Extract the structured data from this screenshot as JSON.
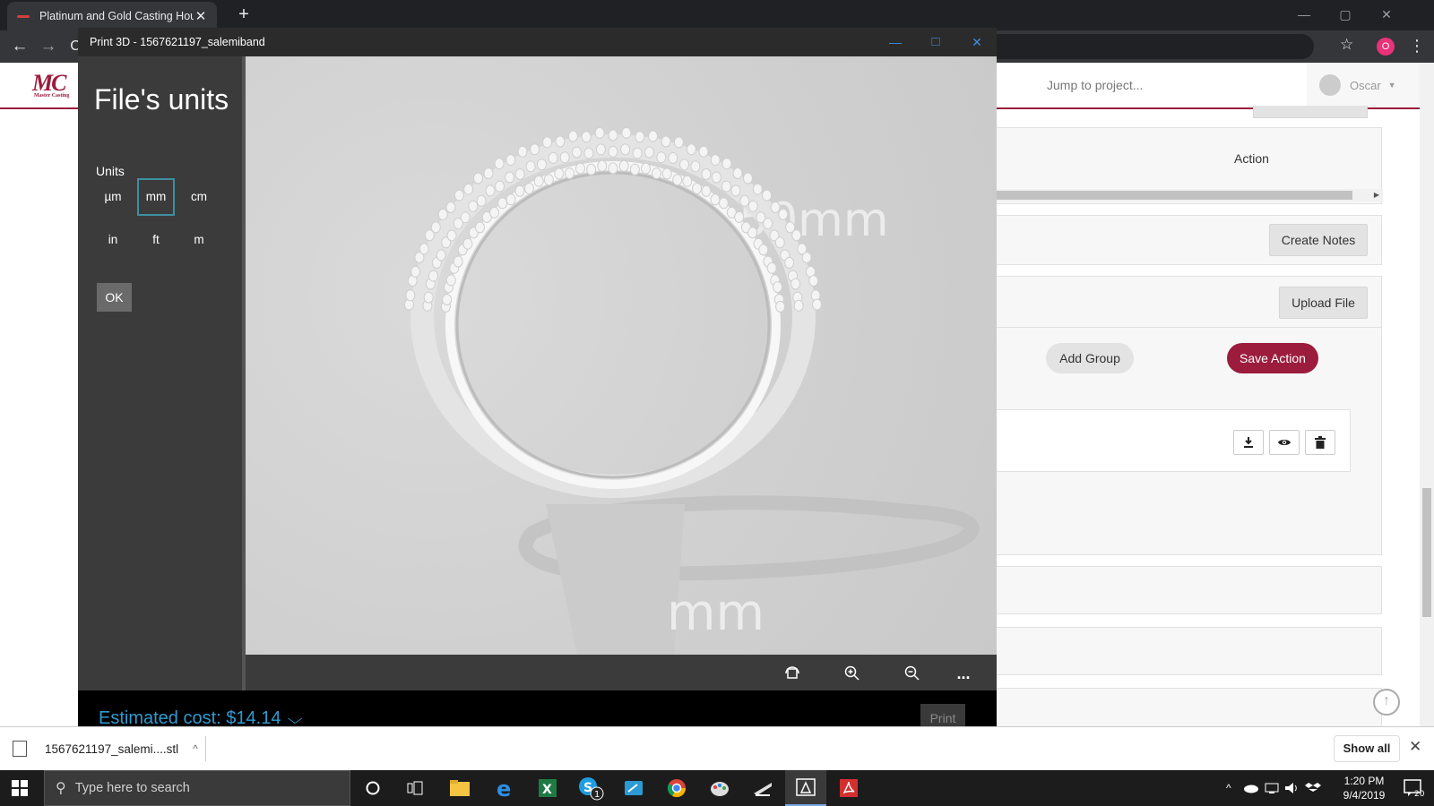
{
  "browser": {
    "tab_title": "Platinum and Gold Casting House",
    "tab_close": "✕",
    "new_tab": "+",
    "window_controls": [
      "—",
      "▢",
      "✕"
    ],
    "back": "←",
    "forward": "→",
    "reload": "C",
    "star": "☆",
    "profile_initial": "O",
    "menu": "⋮"
  },
  "site": {
    "logo_text": "MC",
    "logo_sub": "Master Casting",
    "jump_placeholder": "Jump to project...",
    "user_name": "Oscar",
    "user_caret": "▼",
    "action_header": "Action",
    "create_notes_label": "Create Notes",
    "upload_file_label": "Upload File",
    "add_group_label": "Add Group",
    "save_action_label": "Save Action",
    "scroll_right": "▶",
    "back_to_top": "↑"
  },
  "print3d": {
    "window_title": "Print 3D - 1567621197_salemiband",
    "controls": [
      "—",
      "□",
      "✕"
    ],
    "heading": "File's units",
    "units_label": "Units",
    "units": [
      "µm",
      "mm",
      "cm",
      "in",
      "ft",
      "m"
    ],
    "selected_unit": "mm",
    "ok_label": "OK",
    "viewport_labels": [
      "50mm",
      "mm"
    ],
    "toolbar_more": "...",
    "estimated_cost": "Estimated cost: $14.14",
    "cost_chevron": "⌵",
    "print_label": "Print"
  },
  "downloads": {
    "file_name": "1567621197_salemi....stl",
    "caret": "^",
    "show_all_label": "Show all",
    "close": "✕"
  },
  "taskbar": {
    "search_placeholder": "Type here to search",
    "search_icon": "⚲",
    "skype_badge": "1",
    "time": "1:20 PM",
    "date": "9/4/2019",
    "notification_count": "20",
    "tray_caret": "^"
  },
  "colors": {
    "brand": "#9b1c3d",
    "cost_blue": "#2f9bd0",
    "unit_selected_border": "#3e8ea0",
    "title_controls_blue": "#3f8de0"
  }
}
